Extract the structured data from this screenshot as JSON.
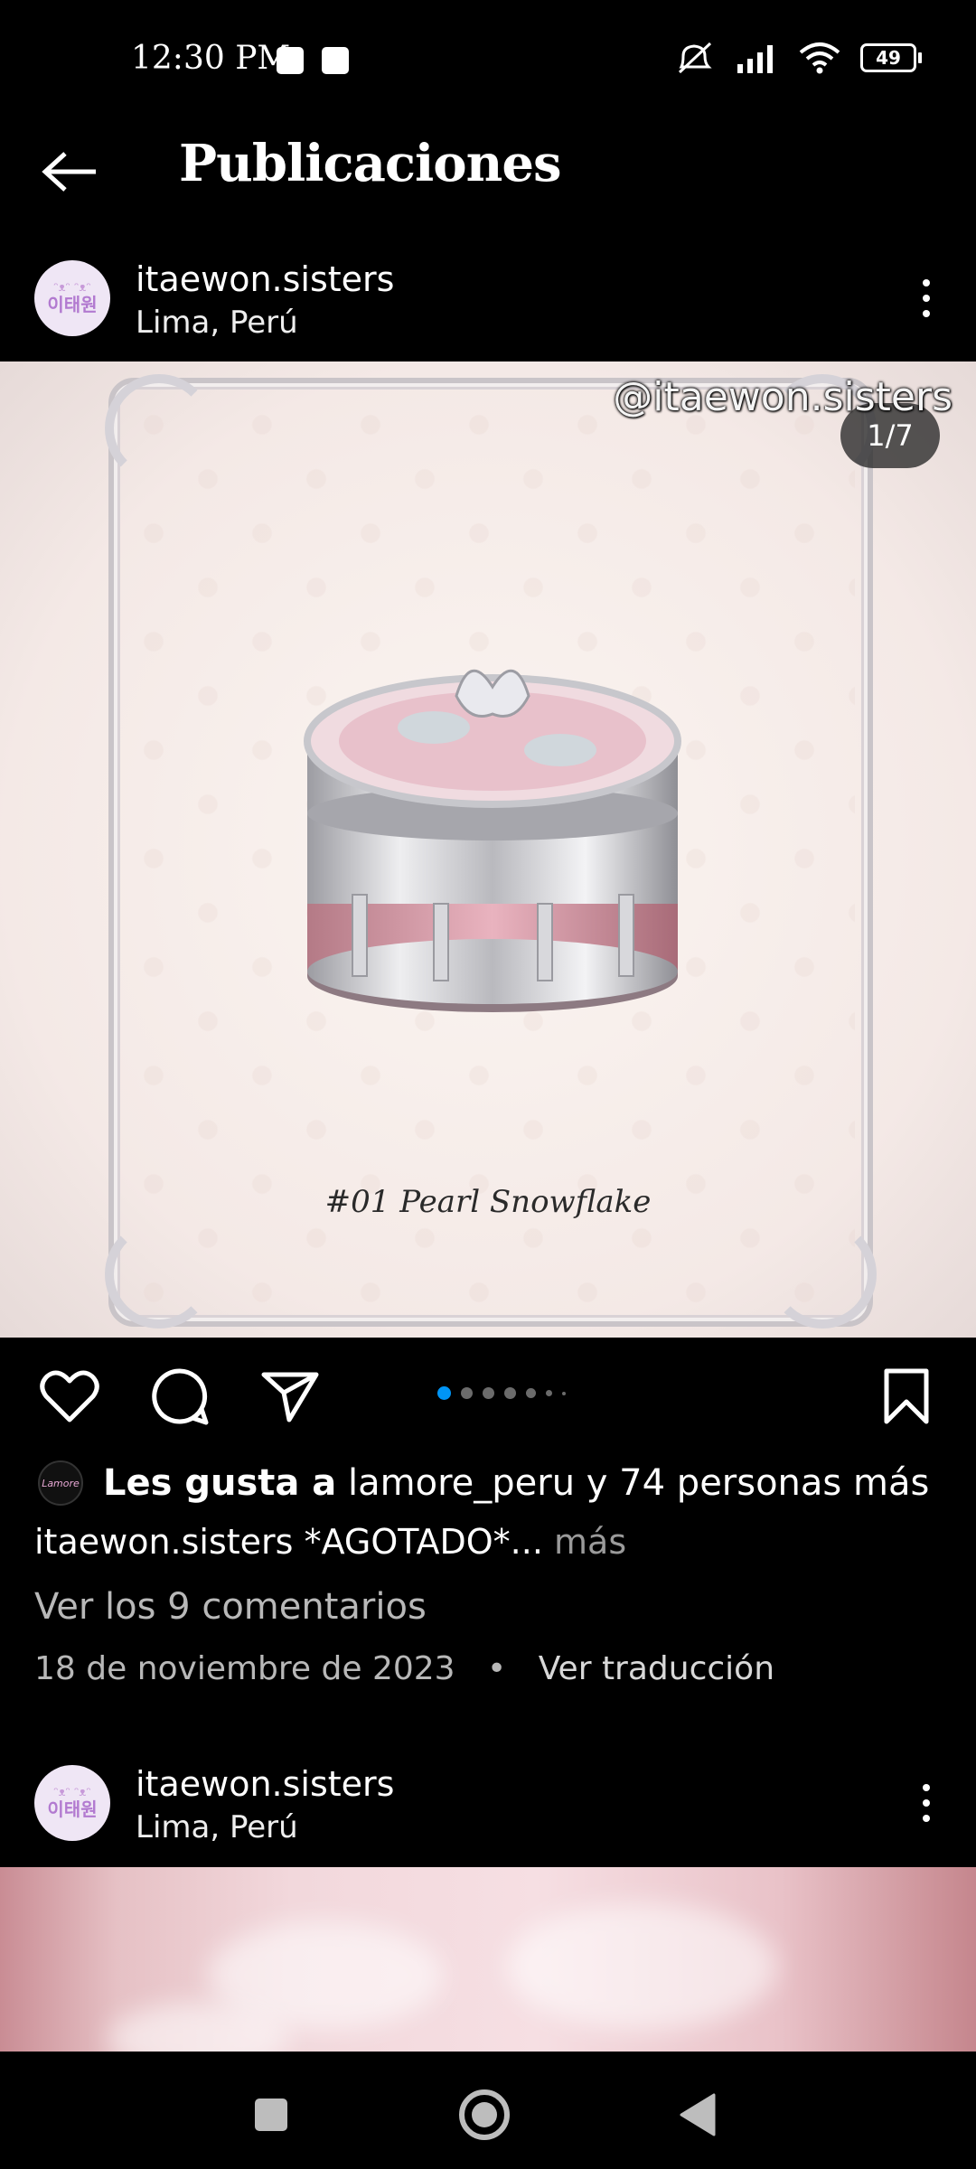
{
  "status_bar": {
    "time": "12:30 PM",
    "battery": "49",
    "icons": [
      "notification-square",
      "notification-square",
      "mute-icon",
      "signal-icon",
      "wifi-icon",
      "battery-icon"
    ]
  },
  "header": {
    "title": "Publicaciones",
    "back_icon": "back-arrow-icon"
  },
  "post": {
    "username": "itaewon.sisters",
    "location": "Lima, Perú",
    "avatar_text": "이태원",
    "media": {
      "watermark": "@itaewon.sisters",
      "counter": "1/7",
      "product_caption": "#01 Pearl Snowflake",
      "slides": 7,
      "current_slide": 1
    },
    "likes": {
      "prefix": "Les gusta a",
      "liker": "lamore_peru",
      "suffix": "y 74 personas más"
    },
    "caption": {
      "username": "itaewon.sisters",
      "text": "*AGOTADO*...",
      "more": "más"
    },
    "comments_link": "Ver los 9 comentarios",
    "date": "18 de noviembre de 2023",
    "separator": "•",
    "translate": "Ver traducción"
  },
  "next_post": {
    "username": "itaewon.sisters",
    "location": "Lima, Perú",
    "avatar_text": "이태원"
  },
  "colors": {
    "background": "#000000",
    "active_dot": "#0095f6",
    "inactive_dot": "#6b6b6b",
    "secondary_text": "#b8b8b8"
  }
}
